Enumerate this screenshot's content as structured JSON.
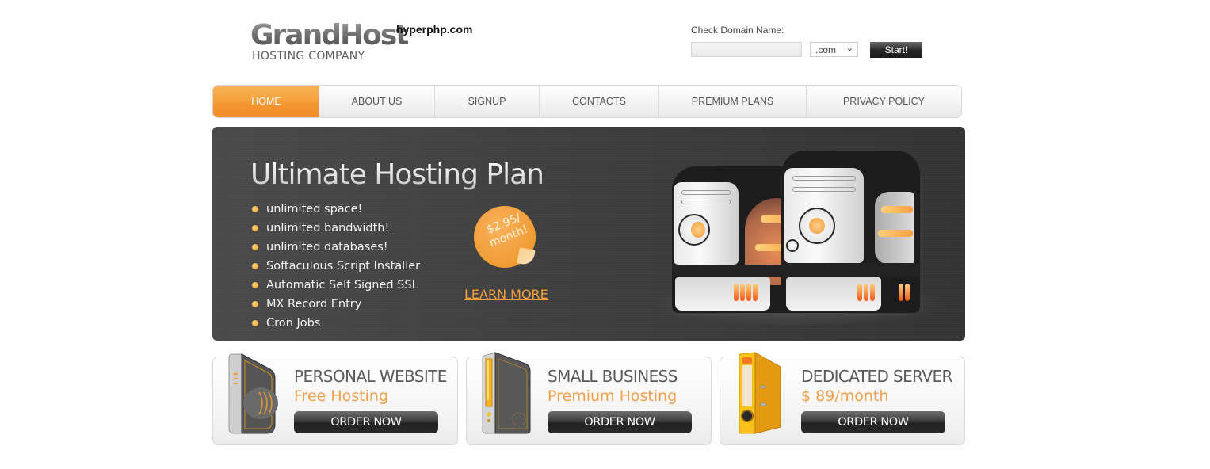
{
  "header": {
    "logo_main": "GrandHost",
    "logo_sub": "HOSTING COMPANY",
    "site_domain": "hyperphp.com"
  },
  "domain_check": {
    "label": "Check Domain Name:",
    "input_value": "",
    "input_placeholder": "",
    "tld_selected": ".com",
    "start_label": "Start!"
  },
  "nav": {
    "items": [
      {
        "label": "HOME",
        "active": true
      },
      {
        "label": "ABOUT US"
      },
      {
        "label": "SIGNUP"
      },
      {
        "label": "CONTACTS"
      },
      {
        "label": "PREMIUM PLANS"
      },
      {
        "label": "PRIVACY POLICY"
      }
    ]
  },
  "banner": {
    "title": "Ultimate Hosting Plan",
    "features": [
      "unlimited space!",
      "unlimited bandwidth!",
      "unlimited databases!",
      "Softaculous Script Installer",
      "Automatic Self Signed SSL",
      "MX Record Entry",
      "Cron Jobs"
    ],
    "price_line1": "$2.95/",
    "price_line2": "month!",
    "learn_more": "LEARN MORE"
  },
  "cards": [
    {
      "title": "PERSONAL WEBSITE",
      "subtitle": "Free Hosting",
      "button": "ORDER NOW",
      "icon": "router-icon"
    },
    {
      "title": "SMALL BUSINESS",
      "subtitle": "Premium Hosting",
      "button": "ORDER NOW",
      "icon": "server-tower-icon"
    },
    {
      "title": "DEDICATED SERVER",
      "subtitle": "$ 89/month",
      "button": "ORDER NOW",
      "icon": "binder-icon"
    }
  ],
  "colors": {
    "accent": "#f39530",
    "accent_text": "#f0a04a",
    "banner_bg": "#3f3e3e",
    "button_dark": "#2a2a2a"
  }
}
